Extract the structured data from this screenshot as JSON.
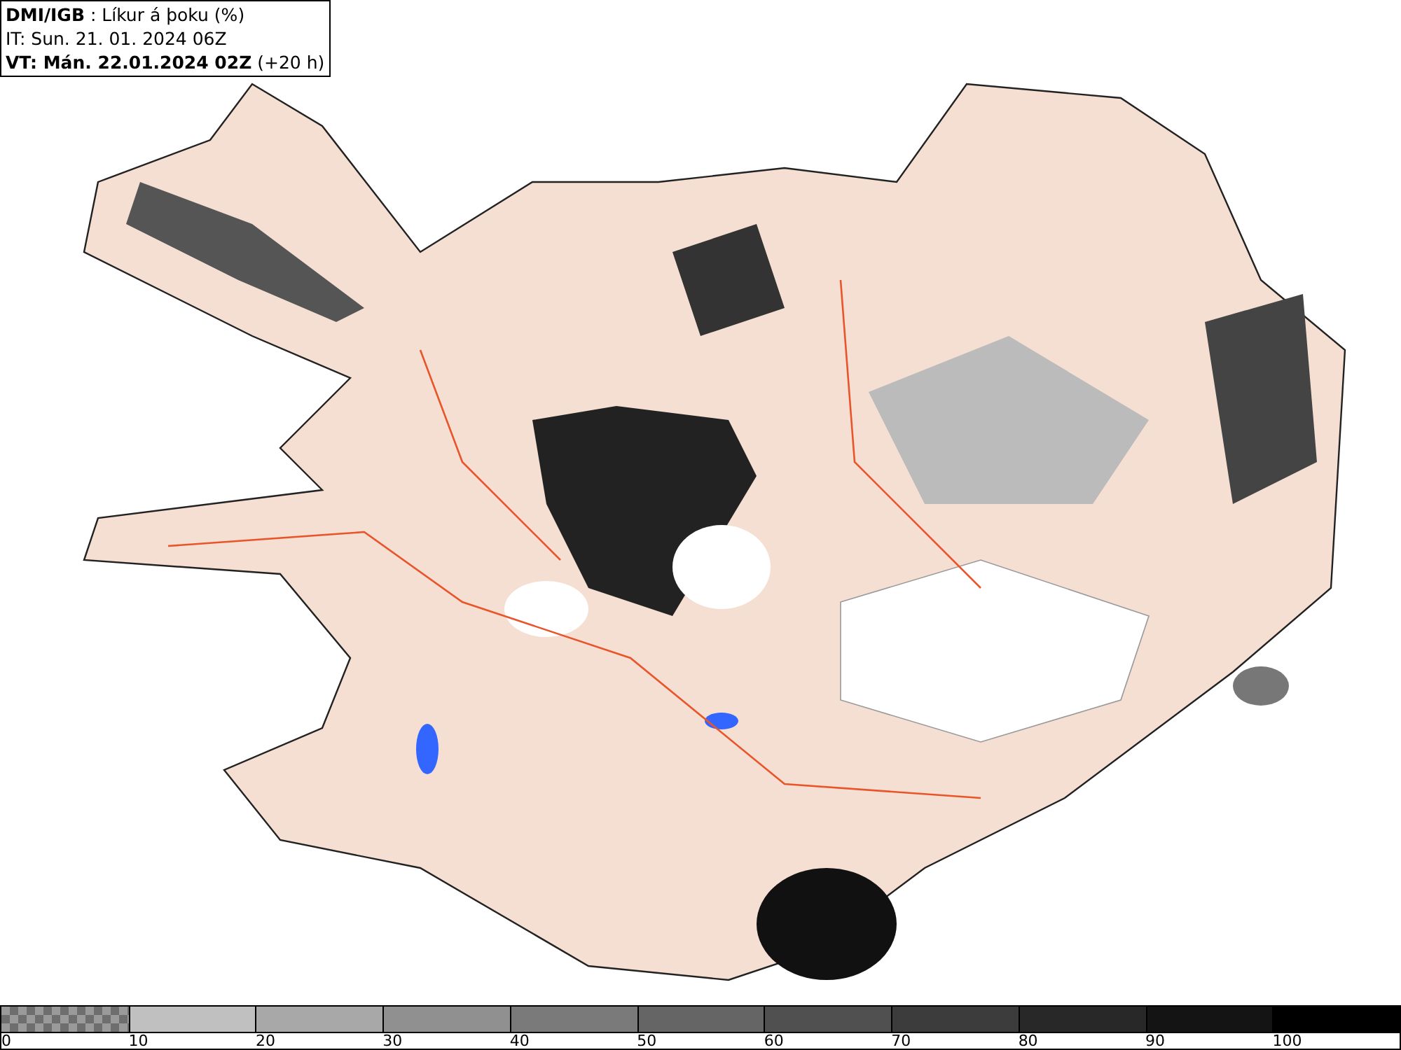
{
  "title_box": {
    "lines": [
      "**DMI/IGB** : Líkur á þoku (%)",
      "IT: Sun. 21. 01. 2024 06Z",
      "**VT: Mán. 22.01.2024 02Z** (+20 h)"
    ]
  },
  "legend": {
    "bins": [
      {
        "label": "0",
        "kind": "checker",
        "color": "#6e6e6e"
      },
      {
        "label": "10",
        "kind": "solid",
        "color": "#c0c0c0"
      },
      {
        "label": "20",
        "kind": "solid",
        "color": "#a8a8a8"
      },
      {
        "label": "30",
        "kind": "solid",
        "color": "#909090"
      },
      {
        "label": "40",
        "kind": "solid",
        "color": "#7a7a7a"
      },
      {
        "label": "50",
        "kind": "solid",
        "color": "#656565"
      },
      {
        "label": "60",
        "kind": "solid",
        "color": "#505050"
      },
      {
        "label": "70",
        "kind": "solid",
        "color": "#3c3c3c"
      },
      {
        "label": "80",
        "kind": "solid",
        "color": "#282828"
      },
      {
        "label": "90",
        "kind": "solid",
        "color": "#141414"
      },
      {
        "label": "100",
        "kind": "solid",
        "color": "#000000"
      }
    ]
  }
}
